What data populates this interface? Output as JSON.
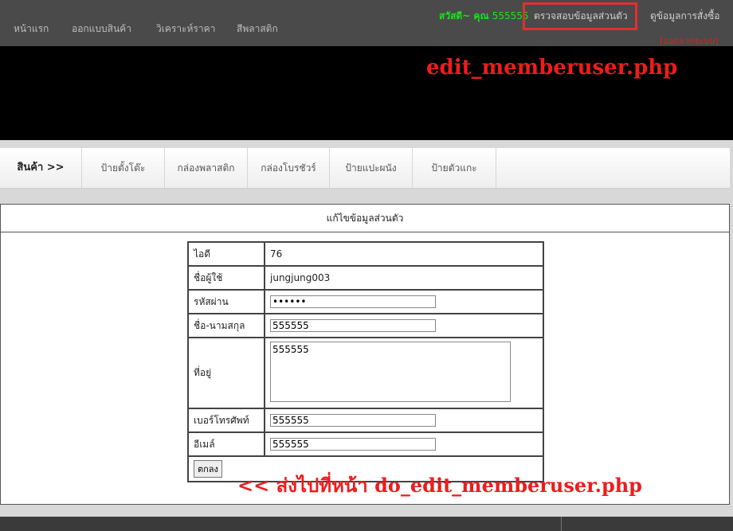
{
  "topnav": {
    "items": [
      "หน้าแรก",
      "ออกแบบสินค้า",
      "วิเคราะห์ราคา",
      "สีพลาสติก"
    ],
    "greeting": "สวัสดี~ คุณ",
    "username": "555555",
    "profile_link": "ตรวจสอบข้อมูลส่วนตัว",
    "orders_link": "ดูข้อมูลการสั่งซื้อ",
    "logout": "[ออกจากระบบ]"
  },
  "annotations": {
    "top": "edit_memberuser.php",
    "bottom": "<< ส่งไปที่หน้า do_edit_memberuser.php"
  },
  "products": {
    "header": "สินค้า >>",
    "items": [
      "ป้ายตั้งโต๊ะ",
      "กล่องพลาสติก",
      "กล่องโบรชัวร์",
      "ป้ายแปะผนัง",
      "ป้ายตัวแกะ"
    ]
  },
  "form": {
    "title": "แก้ไขข้อมูลส่วนตัว",
    "id_label": "ไอดี",
    "id_value": "76",
    "username_label": "ชื่อผู้ใช้",
    "username_value": "jungjung003",
    "password_label": "รหัสผ่าน",
    "password_value": "555555",
    "name_label": "ชื่อ-นามสกุล",
    "name_value": "555555",
    "address_label": "ที่อยู่",
    "address_value": "555555",
    "phone_label": "เบอร์โทรศัพท์",
    "phone_value": "555555",
    "email_label": "อีเมล์",
    "email_value": "555555",
    "submit_label": "ตกลง"
  },
  "colors": {
    "highlight": "#e03030",
    "greeting": "#19e619"
  }
}
